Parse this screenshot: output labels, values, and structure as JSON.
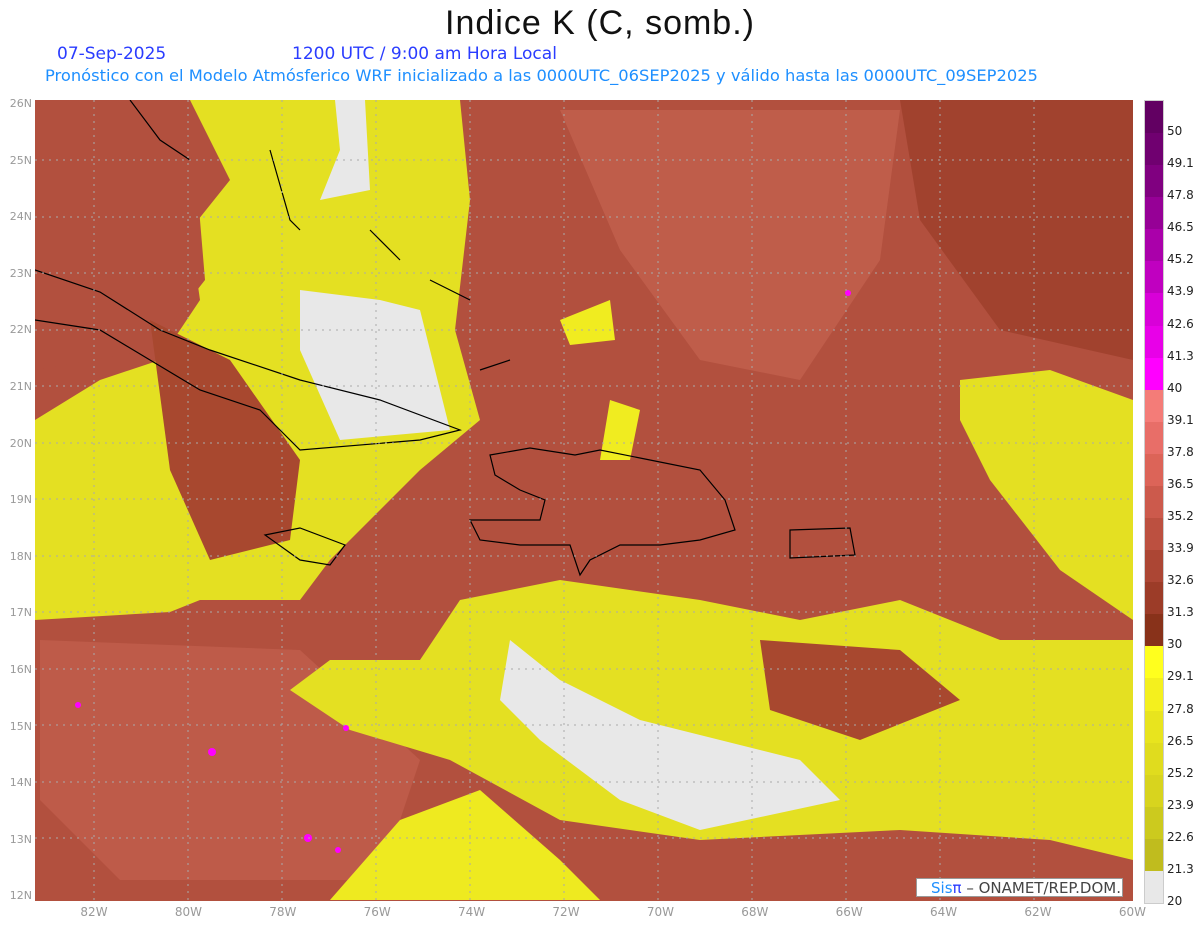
{
  "title": "Indice K (C, somb.)",
  "date": "07-Sep-2025",
  "time": "1200 UTC / 9:00 am Hora Local",
  "subtitle": "Pronóstico con el Modelo Atmósferico WRF inicializado a las 0000UTC_06SEP2025 y válido hasta las  0000UTC_09SEP2025",
  "lat_labels": [
    "26N",
    "25N",
    "24N",
    "23N",
    "22N",
    "21N",
    "20N",
    "19N",
    "18N",
    "17N",
    "16N",
    "15N",
    "14N",
    "13N",
    "12N"
  ],
  "lon_labels": [
    "82W",
    "80W",
    "78W",
    "76W",
    "74W",
    "72W",
    "70W",
    "68W",
    "66W",
    "64W",
    "62W",
    "60W"
  ],
  "colorbar": {
    "labels": [
      "50",
      "49.1",
      "47.8",
      "46.5",
      "45.2",
      "43.9",
      "42.6",
      "41.3",
      "40",
      "39.1",
      "37.8",
      "36.5",
      "35.2",
      "33.9",
      "32.6",
      "31.3",
      "30",
      "29.1",
      "27.8",
      "26.5",
      "25.2",
      "23.9",
      "22.6",
      "21.3",
      "20"
    ],
    "colors_top_to_bottom": [
      "#620062",
      "#700070",
      "#800080",
      "#960096",
      "#aa00aa",
      "#c000c0",
      "#d800d8",
      "#e800e8",
      "#ff00ff",
      "#f47c78",
      "#e86e68",
      "#dc6458",
      "#cc5a4c",
      "#bc5040",
      "#ac4634",
      "#9c3c28",
      "#88321a",
      "#ffff1e",
      "#f4f01e",
      "#e8e41e",
      "#e0dc1e",
      "#d8d41e",
      "#ccca1e",
      "#c0bc1e",
      "#e8e8e8"
    ]
  },
  "credit": {
    "brand_a": "Sis",
    "brand_b": "π",
    "text": "– ONAMET/REP.DOM."
  }
}
